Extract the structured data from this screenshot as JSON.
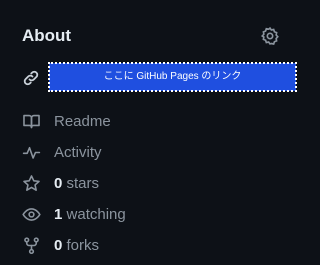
{
  "about": {
    "title": "About",
    "settings_icon": "gear-icon",
    "homepage_icon": "link-icon",
    "homepage_link_text": "ここに GitHub Pages のリンク"
  },
  "sidebar": {
    "items": [
      {
        "icon": "book-icon",
        "count": "",
        "label": "Readme"
      },
      {
        "icon": "pulse-icon",
        "count": "",
        "label": "Activity"
      },
      {
        "icon": "star-icon",
        "count": "0",
        "label": "stars"
      },
      {
        "icon": "eye-icon",
        "count": "1",
        "label": "watching"
      },
      {
        "icon": "repo-forked-icon",
        "count": "0",
        "label": "forks"
      }
    ]
  },
  "colors": {
    "background": "#0d1117",
    "muted_text": "#8b949e",
    "strong_text": "#e6edf3",
    "link_button_bg": "#1f4fe0"
  }
}
